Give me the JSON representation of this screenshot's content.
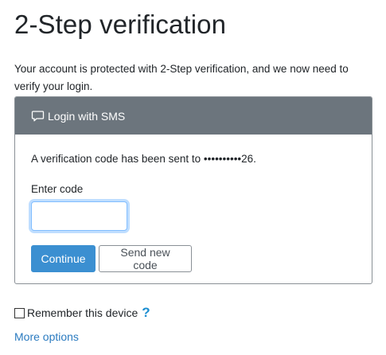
{
  "header": {
    "title": "2-Step verification"
  },
  "intro": {
    "text": "Your account is protected with 2-Step verification, and we now need to verify your login."
  },
  "card": {
    "header_icon": "chat-bubble-icon",
    "header_label": "Login with SMS",
    "sent_message": "A verification code has been sent to ••••••••••26.",
    "code_label": "Enter code",
    "code_value": "",
    "continue_label": "Continue",
    "resend_label": "Send new code"
  },
  "footer": {
    "remember_label": "Remember this device",
    "remember_checked": false,
    "help_icon": "question-mark-icon",
    "more_options_label": "More options"
  },
  "colors": {
    "card_header_bg": "#6c757d",
    "primary_button": "#3b8fd1",
    "link": "#2b7bc0",
    "help_icon": "#1b8ed1"
  }
}
